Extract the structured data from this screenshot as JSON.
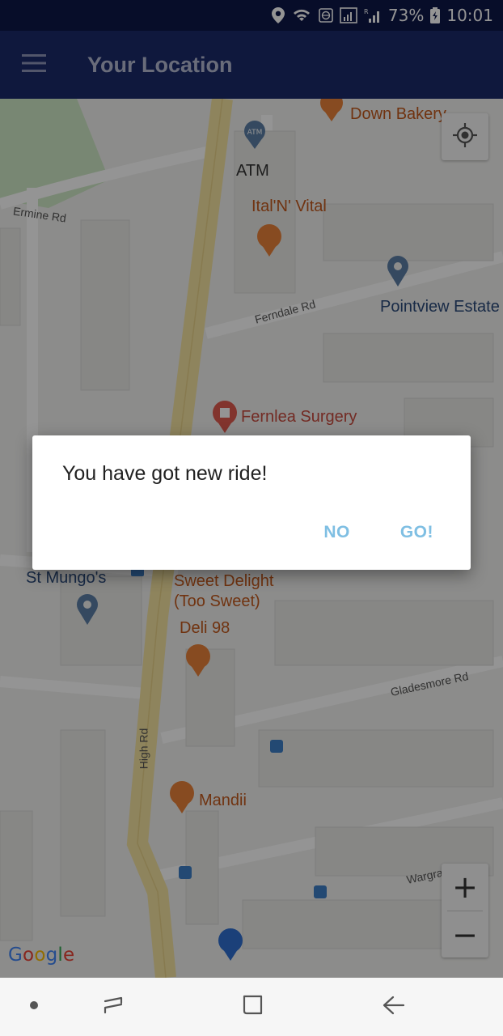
{
  "status_bar": {
    "battery": "73%",
    "time": "10:01"
  },
  "app_bar": {
    "title": "Your Location",
    "menu_icon": "hamburger-menu-icon"
  },
  "map": {
    "labels": {
      "bakery": "Down Bakery",
      "atm": "ATM",
      "ital": "Ital'N' Vital",
      "ermine": "Ermine Rd",
      "ferndale": "Ferndale Rd",
      "pointview": "Pointview Estate",
      "fernlea": "Fernlea Surgery",
      "st_mungos": "St Mungo's",
      "sweet1": "Sweet Delight",
      "sweet2": "(Too Sweet)",
      "deli": "Deli 98",
      "gladesmore": "Gladesmore Rd",
      "high_rd": "High Rd",
      "mandii": "Mandii",
      "wargrave": "Wargrave Ave"
    },
    "atm_pin_text": "ATM",
    "zoom_in": "+",
    "zoom_out": "−",
    "google": [
      "G",
      "o",
      "o",
      "g",
      "l",
      "e"
    ],
    "colors": {
      "park": "#cfe8c6",
      "road_major": "#f4e3a1",
      "poi_orange": "#e8823a",
      "poi_red": "#e05a4e",
      "pin_blue": "#5c7fa6",
      "pin_deepblue": "#2f6fd0"
    }
  },
  "dialog": {
    "message": "You have got new ride!",
    "no_label": "NO",
    "go_label": "GO!",
    "accent": "#7fbfe3"
  },
  "nav_bar": {
    "dot_icon": "nav-dot-icon",
    "recents_icon": "recent-apps-icon",
    "home_icon": "home-icon",
    "back_icon": "back-icon"
  }
}
